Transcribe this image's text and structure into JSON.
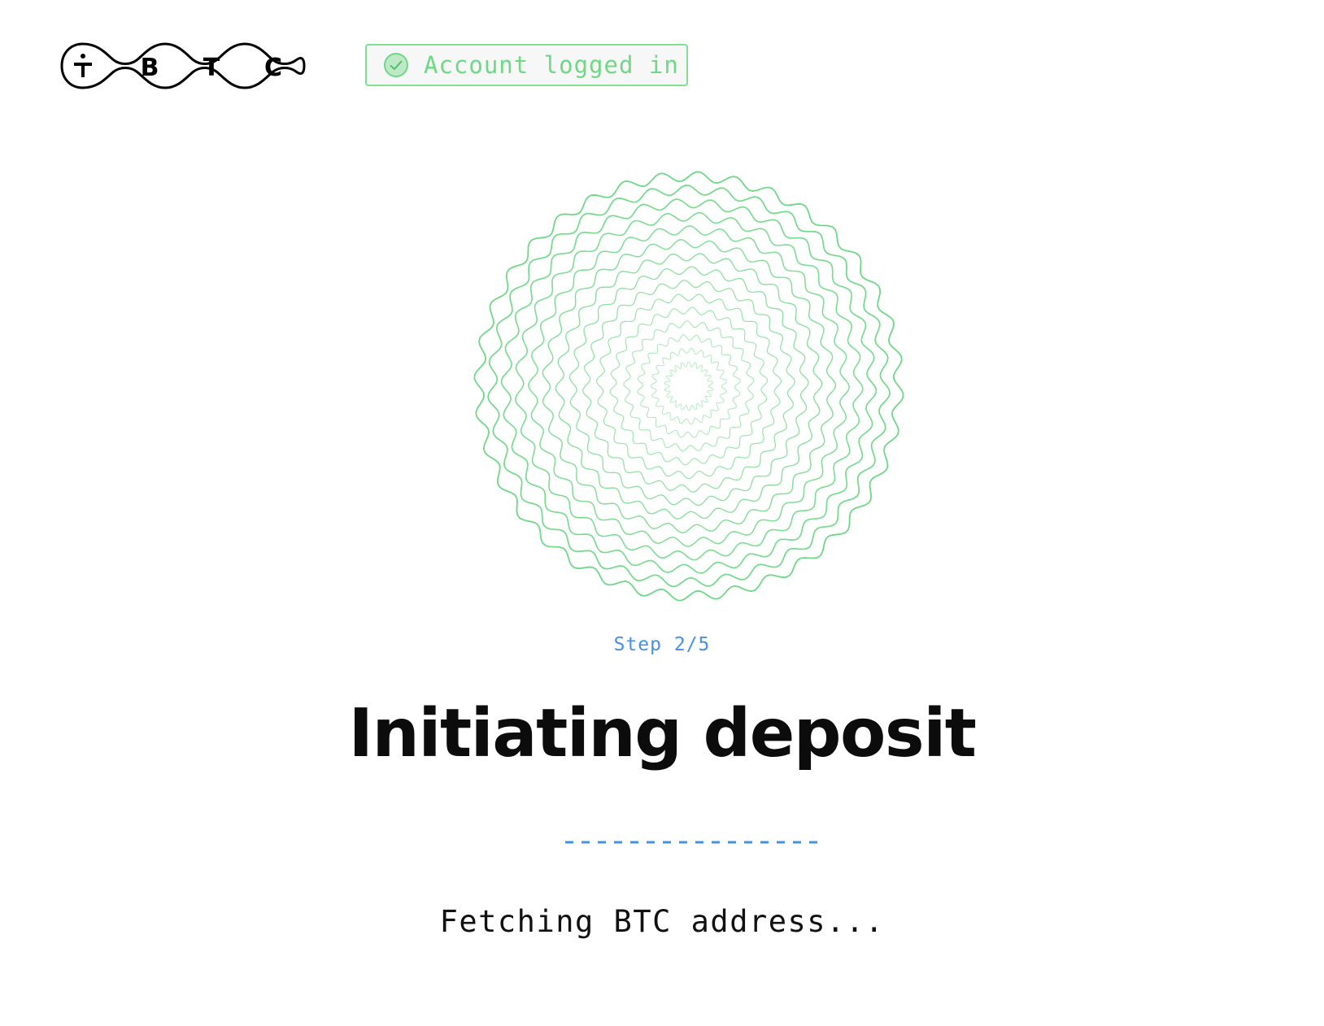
{
  "brand": {
    "logo_letters": [
      "B",
      "T",
      "C"
    ],
    "logo_name": "tBTC"
  },
  "auth": {
    "status_label": "Account logged in",
    "status_icon": "check-circle-icon",
    "status_color": "#6fd886"
  },
  "progress": {
    "step_label": "Step 2/5",
    "current_step": 2,
    "total_steps": 5
  },
  "main": {
    "title": "Initiating deposit",
    "status_message": "Fetching BTC address..."
  },
  "colors": {
    "accent_green": "#6fd886",
    "accent_blue": "#4a90e2",
    "text": "#0c0c0c"
  }
}
